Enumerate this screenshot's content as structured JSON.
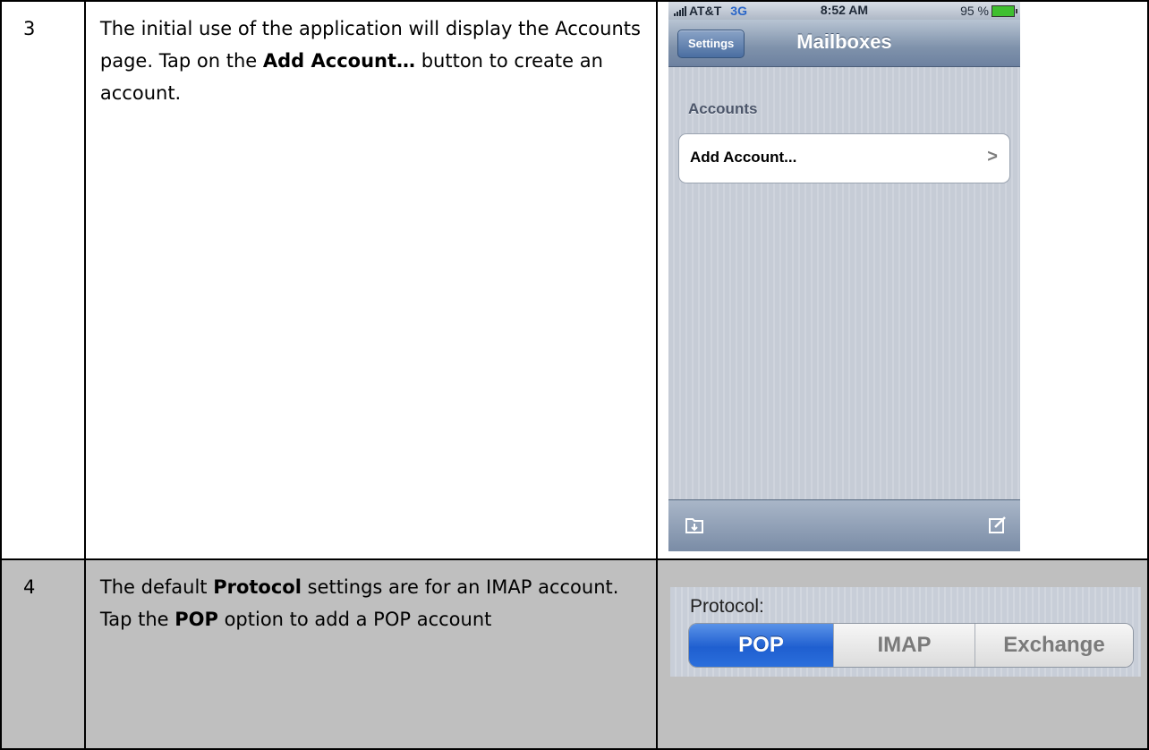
{
  "steps": [
    {
      "number": "3",
      "text_pre": "The initial use of the application will display the Accounts page.  Tap on the ",
      "text_bold": "Add Account…",
      "text_post": " button to create an account."
    },
    {
      "number": "4",
      "text_pre": "The default ",
      "text_bold": "Protocol",
      "text_mid": " settings are for an IMAP account.  Tap the ",
      "text_bold2": "POP",
      "text_post": " option to add a POP account"
    }
  ],
  "phone": {
    "carrier": "AT&T",
    "network": "3G",
    "time": "8:52 AM",
    "battery": "95 %",
    "battery_color": "#3fbf2f",
    "back_button": "Settings",
    "title": "Mailboxes",
    "section_header": "Accounts",
    "cell_label": "Add Account...",
    "cell_accessory": ">",
    "toolbar_left_icon": "refresh-mailbox-icon",
    "toolbar_right_icon": "compose-icon"
  },
  "protocol": {
    "label": "Protocol:",
    "options": [
      "POP",
      "IMAP",
      "Exchange"
    ],
    "selected": "POP",
    "selected_color": "#1f5fd0"
  }
}
